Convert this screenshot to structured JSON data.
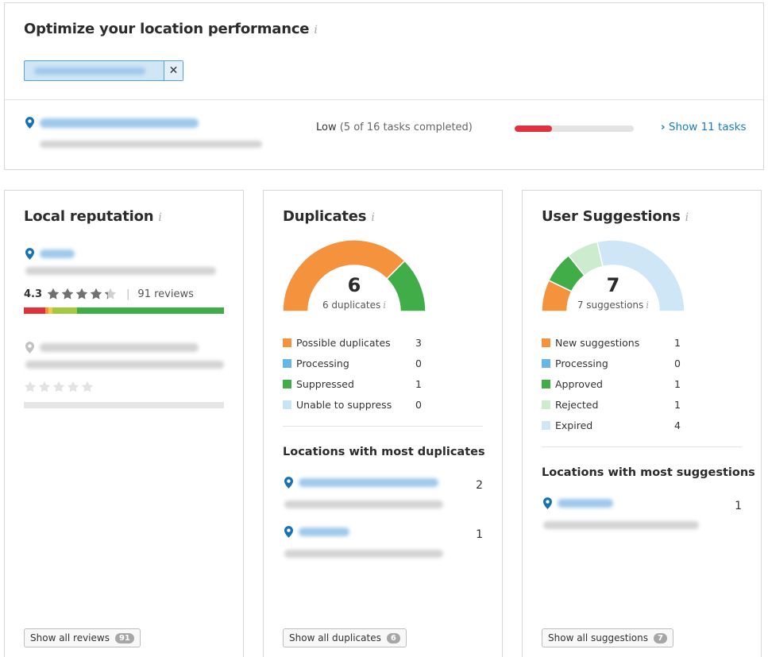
{
  "header": {
    "title": "Optimize your location performance",
    "info": "i"
  },
  "summary": {
    "status_level": "Low",
    "status_detail": "(5 of 16 tasks completed)",
    "tasks_completed": 5,
    "tasks_total": 16,
    "progress_fraction": 0.3125,
    "show_tasks": "Show 11 tasks",
    "progress_color": "#e0323c"
  },
  "reputation": {
    "title": "Local reputation",
    "info": "i",
    "rating": "4.3",
    "rating_value": 4.3,
    "reviews": "91 reviews",
    "stars_second": 0,
    "show_all": "Show all reviews",
    "show_all_count": "91"
  },
  "duplicates": {
    "title": "Duplicates",
    "info": "i",
    "total": "6",
    "subtitle": "6 duplicates",
    "legend": [
      {
        "label": "Possible duplicates",
        "value": "3",
        "color": "#f5923e"
      },
      {
        "label": "Processing",
        "value": "0",
        "color": "#66b6e6"
      },
      {
        "label": "Suppressed",
        "value": "1",
        "color": "#41ad49"
      },
      {
        "label": "Unable to suppress",
        "value": "0",
        "color": "#c9e3f5"
      }
    ],
    "locations_title": "Locations with most duplicates",
    "locations": [
      {
        "count": "2"
      },
      {
        "count": "1"
      }
    ],
    "show_all": "Show all duplicates",
    "show_all_count": "6"
  },
  "suggestions": {
    "title": "User Suggestions",
    "info": "i",
    "total": "7",
    "subtitle": "7 suggestions",
    "legend": [
      {
        "label": "New suggestions",
        "value": "1",
        "color": "#f5923e"
      },
      {
        "label": "Processing",
        "value": "0",
        "color": "#66b6e6"
      },
      {
        "label": "Approved",
        "value": "1",
        "color": "#41ad49"
      },
      {
        "label": "Rejected",
        "value": "1",
        "color": "#cdebcf"
      },
      {
        "label": "Expired",
        "value": "4",
        "color": "#cfe6f6"
      }
    ],
    "locations_title": "Locations with most suggestions",
    "locations": [
      {
        "count": "1"
      }
    ],
    "show_all": "Show all suggestions",
    "show_all_count": "7"
  },
  "icons": {
    "pin": "map-pin-icon",
    "close": "close-icon",
    "chevron": "chevron-right-icon",
    "star": "star-icon",
    "info": "info-icon"
  },
  "colors": {
    "brand_blue": "#1b7bbf",
    "pin_blue": "#1672b5",
    "star_gray": "#707070"
  }
}
